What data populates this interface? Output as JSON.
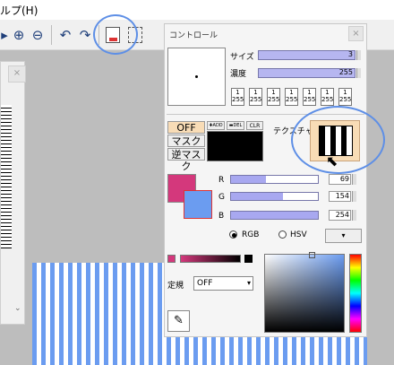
{
  "menubar": {
    "help_label": "ルプ(H)"
  },
  "panel": {
    "title": "コントロール",
    "close": "×",
    "size_label": "サイズ",
    "size_value": "3",
    "density_label": "濃度",
    "density_value": "255",
    "fractions": [
      {
        "num": "1",
        "den": "255"
      },
      {
        "num": "1",
        "den": "255"
      },
      {
        "num": "1",
        "den": "255"
      },
      {
        "num": "1",
        "den": "255"
      },
      {
        "num": "1",
        "den": "255"
      },
      {
        "num": "1",
        "den": "255"
      },
      {
        "num": "1",
        "den": "255"
      }
    ],
    "mask_off": "OFF",
    "mask": "マスク",
    "reverse_mask": "逆マスク",
    "add": "✚ADD",
    "del": "▬DEL",
    "clr": "CLR",
    "texture_label": "テクスチャ",
    "r_label": "R",
    "g_label": "G",
    "b_label": "B",
    "r_value": "69",
    "g_value": "154",
    "b_value": "254",
    "rgb_label": "RGB",
    "hsv_label": "HSV",
    "mode_label": "定規",
    "mode_value": "OFF",
    "colors": {
      "main": "#d4387c",
      "sub": "#6b9cf0"
    }
  },
  "canvas_close": "×"
}
